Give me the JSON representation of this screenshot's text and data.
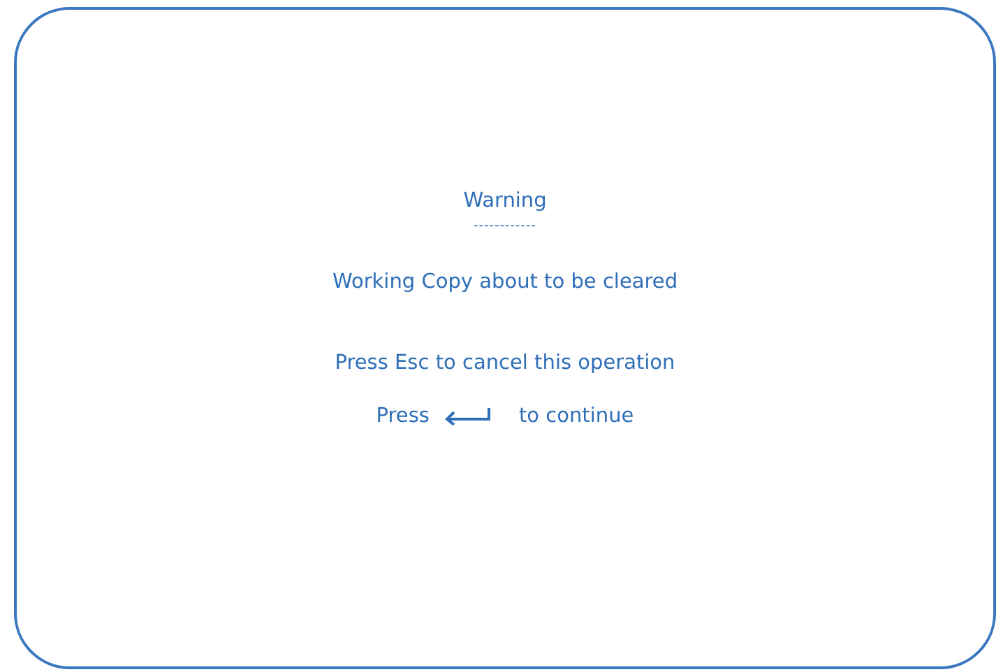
{
  "dialog": {
    "title": "Warning",
    "title_rule": "------------",
    "message": "Working Copy about to be cleared",
    "cancel_hint": "Press Esc to cancel this operation",
    "continue_hint": {
      "before": "Press",
      "after": "to continue"
    }
  }
}
